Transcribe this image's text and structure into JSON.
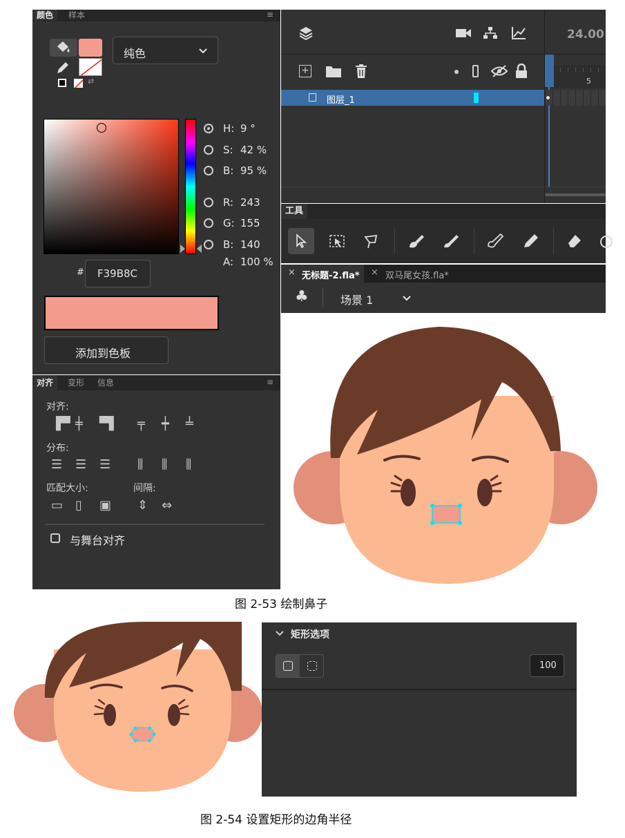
{
  "color_panel": {
    "tabs": [
      "颜色",
      "样本"
    ],
    "fill_type": "纯色",
    "hsb": [
      {
        "key": "H:",
        "value": "9 °"
      },
      {
        "key": "S:",
        "value": "42 %"
      },
      {
        "key": "B:",
        "value": "95 %"
      }
    ],
    "rgb": [
      {
        "key": "R:",
        "value": "243"
      },
      {
        "key": "G:",
        "value": "155"
      },
      {
        "key": "B:",
        "value": "140"
      }
    ],
    "alpha": {
      "key": "A:",
      "value": "100 %"
    },
    "hex_label": "#",
    "hex_value": "F39B8C",
    "swatch_color": "#F39B8C",
    "add_button": "添加到色板"
  },
  "align_panel": {
    "tabs": [
      "对齐",
      "变形",
      "信息"
    ],
    "align_label": "对齐:",
    "distribute_label": "分布:",
    "match_label": "匹配大小:",
    "spacing_label": "间隔:",
    "stage_checkbox": "与舞台对齐"
  },
  "timeline": {
    "fps": "24.00",
    "frame_number": "5",
    "layer_name": "图层_1"
  },
  "tools_panel": {
    "title": "工具"
  },
  "doc_tabs": [
    {
      "label": "无标题-2.fla*"
    },
    {
      "label": "双马尾女孩.fla*"
    }
  ],
  "scene": {
    "label": "场景 1"
  },
  "captions": {
    "fig1": "图 2-53 绘制鼻子",
    "fig2": "图 2-54 设置矩形的边角半径"
  },
  "rect_options": {
    "title": "矩形选项",
    "radius_value": "100"
  },
  "colors": {
    "panel_bg": "#323232",
    "hair": "#6B3B2A",
    "skin": "#FCB891",
    "ear": "#E2907A",
    "nose": "#F39B8C",
    "selection": "#3A6EA5",
    "accent_cyan": "#00E5FF"
  }
}
